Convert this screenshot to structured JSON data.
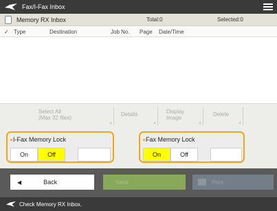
{
  "header": {
    "title": "Fax/I-Fax Inbox",
    "menu_icon": "hamburger-menu-icon"
  },
  "inbox": {
    "title": "Memory RX Inbox",
    "total": "Total:0",
    "selected": "Selected:0"
  },
  "columns": [
    "Type",
    "Destination",
    "Job No.",
    "Page",
    "Date/Time"
  ],
  "actions": {
    "select_all_line1": "Select All",
    "select_all_line2": "(Max 32 files)",
    "details": "Details",
    "display_line1": "Display",
    "display_line2": "Image",
    "delete": "Delete"
  },
  "ifax_lock": {
    "label": "I-Fax Memory Lock",
    "on": "On",
    "off": "Off",
    "selected": "Off"
  },
  "fax_lock": {
    "label": "Fax Memory Lock",
    "on": "On",
    "off": "Off",
    "selected": "On"
  },
  "bottom": {
    "back": "Back",
    "send": "Send",
    "print": "Print"
  },
  "status": {
    "message": "Check Memory RX Inbox."
  },
  "colors": {
    "highlight": "#f2a41a",
    "selected_toggle": "#ffff00"
  }
}
